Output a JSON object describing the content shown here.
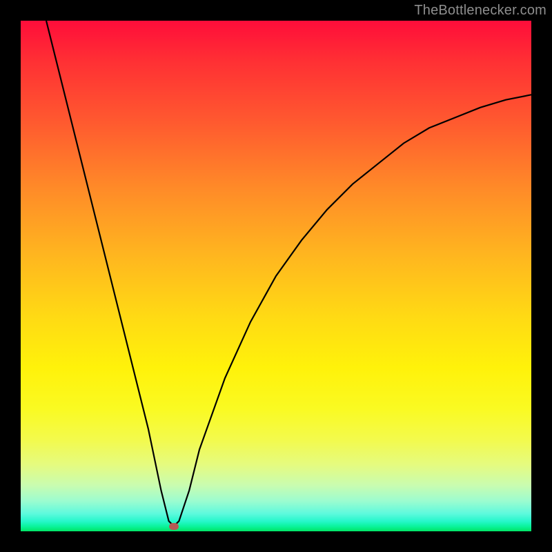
{
  "watermark": "TheBottlenecker.com",
  "chart_data": {
    "type": "line",
    "title": "",
    "xlabel": "",
    "ylabel": "",
    "xlim": [
      0,
      1
    ],
    "ylim": [
      0,
      1
    ],
    "series": [
      {
        "name": "curve",
        "x": [
          0.05,
          0.1,
          0.15,
          0.2,
          0.25,
          0.275,
          0.29,
          0.3,
          0.31,
          0.33,
          0.35,
          0.4,
          0.45,
          0.5,
          0.55,
          0.6,
          0.65,
          0.7,
          0.75,
          0.8,
          0.85,
          0.9,
          0.95,
          1.0
        ],
        "y": [
          1.0,
          0.8,
          0.6,
          0.4,
          0.2,
          0.08,
          0.02,
          0.01,
          0.02,
          0.08,
          0.16,
          0.3,
          0.41,
          0.5,
          0.57,
          0.63,
          0.68,
          0.72,
          0.76,
          0.79,
          0.81,
          0.83,
          0.845,
          0.855
        ],
        "color": "#000000"
      }
    ],
    "marker": {
      "x": 0.3,
      "y": 0.01,
      "color": "#b55a54"
    },
    "background_gradient": {
      "top": "#ff0d3a",
      "middle": "#fff20a",
      "bottom": "#00e565"
    }
  }
}
